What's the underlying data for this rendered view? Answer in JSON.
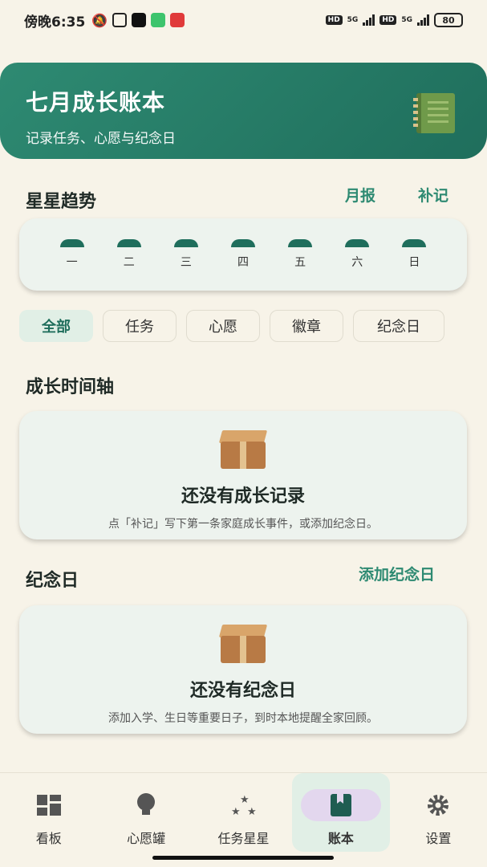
{
  "status_bar": {
    "time": "傍晚6:35",
    "network_1": "5G",
    "network_2": "5G",
    "hd": "HD",
    "battery": "80"
  },
  "header": {
    "title": "七月成长账本",
    "subtitle": "记录任务、心愿与纪念日",
    "icon": "notebook-icon"
  },
  "trend": {
    "title": "星星趋势",
    "monthly_report_label": "月报",
    "backfill_label": "补记",
    "days": [
      "一",
      "二",
      "三",
      "四",
      "五",
      "六",
      "日"
    ]
  },
  "filters": {
    "items": [
      {
        "label": "全部",
        "active": true
      },
      {
        "label": "任务",
        "active": false
      },
      {
        "label": "心愿",
        "active": false
      },
      {
        "label": "徽章",
        "active": false
      },
      {
        "label": "纪念日",
        "active": false
      }
    ]
  },
  "timeline": {
    "title": "成长时间轴",
    "empty_title": "还没有成长记录",
    "empty_desc": "点「补记」写下第一条家庭成长事件，或添加纪念日。"
  },
  "anniversary": {
    "title": "纪念日",
    "add_label": "添加纪念日",
    "empty_title": "还没有纪念日",
    "empty_desc": "添加入学、生日等重要日子，到时本地提醒全家回顾。"
  },
  "nav": {
    "items": [
      {
        "label": "看板",
        "icon": "dashboard-icon",
        "active": false
      },
      {
        "label": "心愿罐",
        "icon": "lightbulb-icon",
        "active": false
      },
      {
        "label": "任务星星",
        "icon": "stars-icon",
        "active": false
      },
      {
        "label": "账本",
        "icon": "book-icon",
        "active": true
      },
      {
        "label": "设置",
        "icon": "gear-icon",
        "active": false
      }
    ]
  },
  "colors": {
    "accent": "#2e8a72",
    "header_dark": "#1f6e5c",
    "background": "#f7f3e8",
    "card": "#edf3ee"
  }
}
